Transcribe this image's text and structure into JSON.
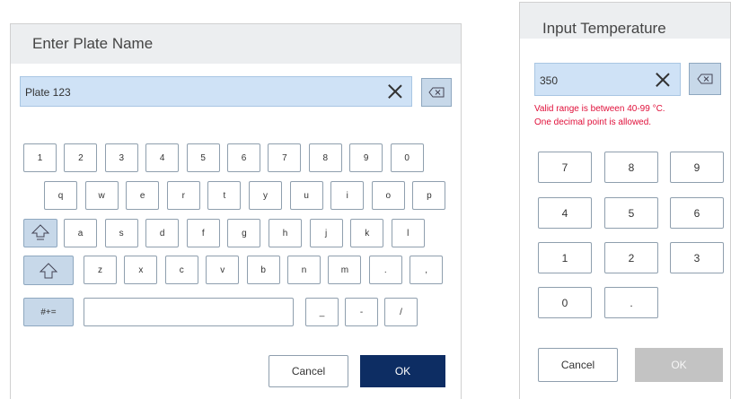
{
  "plate_dialog": {
    "title": "Enter Plate Name",
    "input_value": "Plate 123",
    "rows": [
      [
        "1",
        "2",
        "3",
        "4",
        "5",
        "6",
        "7",
        "8",
        "9",
        "0"
      ],
      [
        "q",
        "w",
        "e",
        "r",
        "t",
        "y",
        "u",
        "i",
        "o",
        "p"
      ],
      [
        "a",
        "s",
        "d",
        "f",
        "g",
        "h",
        "j",
        "k",
        "l"
      ],
      [
        "z",
        "x",
        "c",
        "v",
        "b",
        "n",
        "m",
        ".",
        ","
      ],
      [
        "_",
        "-",
        "/"
      ]
    ],
    "symbols_label": "#+=",
    "cancel_label": "Cancel",
    "ok_label": "OK"
  },
  "temp_dialog": {
    "title": "Input Temperature",
    "input_value": "350",
    "error_line1": "Valid range is between 40-99 °C.",
    "error_line2": "One decimal point is allowed.",
    "keys": [
      "7",
      "8",
      "9",
      "4",
      "5",
      "6",
      "1",
      "2",
      "3",
      "0",
      "."
    ],
    "cancel_label": "Cancel",
    "ok_label": "OK",
    "ok_enabled": false
  },
  "icons": {
    "clear": "close-icon",
    "backspace": "backspace-icon",
    "caps_lock": "caps-lock-icon",
    "shift": "shift-icon"
  },
  "colors": {
    "field_bg": "#cfe2f6",
    "primary_button": "#0d2d63",
    "disabled_button": "#c3c3c3",
    "error_text": "#e0103a",
    "header_bg": "#eceef0"
  }
}
